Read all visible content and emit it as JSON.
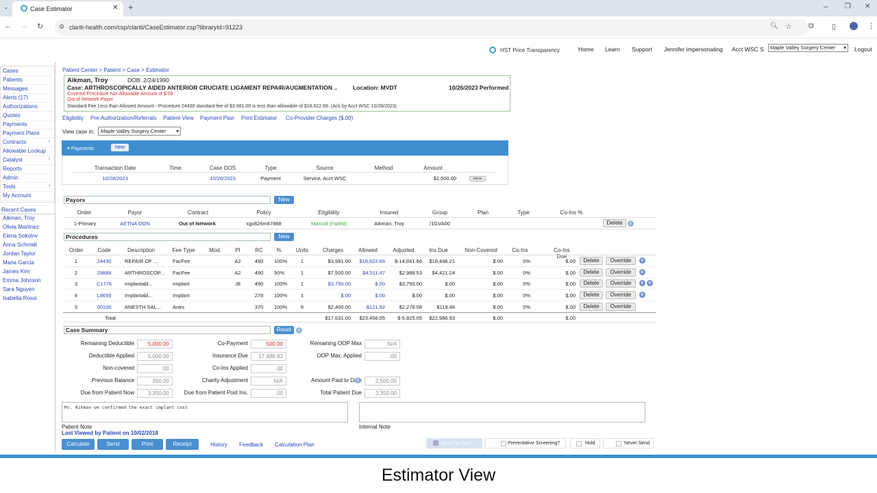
{
  "browser": {
    "tab_title": "Case Estimator",
    "url": "clariti-health.com/csp/clariti/CaseEstimator.csp?libraryId=91223"
  },
  "topnav": {
    "brand": "HST Price Transparency",
    "links": [
      "Home",
      "Learn",
      "Support",
      "Jennifer impersonating",
      "Acct WSC S"
    ],
    "facility": "Maple Valley Surgery Center",
    "logout": "Logout"
  },
  "sidebar": {
    "items": [
      "Cases",
      "Patients",
      "Messages",
      "Alerts (17)",
      "Authorizations",
      "Quotes",
      "Payments",
      "Payment Plans",
      "Contracts",
      "Allowable Lookup",
      "Catalyst",
      "Reports",
      "Admin",
      "Tools",
      "My Account"
    ],
    "recent_title": "Recent Cases",
    "recent": [
      "Aikman, Troy",
      "Olivia Martinez",
      "Elena Sokolov",
      "Anna Schmidt",
      "Jordan Taylor",
      "Maria Garcia",
      "James Kim",
      "Emma Johnson",
      "Sara Nguyen",
      "Isabella Rossi"
    ]
  },
  "breadcrumb": "Patient Center > Patient > Case > Estimator",
  "patient": {
    "name": "Aikman, Troy",
    "dob": "DOB: 2/24/1990",
    "case": "Case: ARTHROSCOPICALLY AIDED ANTERIOR CRUCIATE LIGAMENT REPAIR/AUGMENTATION ..",
    "location": "Location: MVDT",
    "performed": "10/26/2023 Performed",
    "warn1": "Covered Procedure has Allowable Amount of $.00",
    "warn2": "Out of Network Payor",
    "fee_note": "Standard Fee Less than Allowed Amount - Procedure 24430 standard fee of $3,981.00 is less than allowable of $18,822.66. (Ack by Acct WSC 10/28/2023)"
  },
  "links": [
    "Eligibility",
    "Pre-Authorization/Referrals",
    "Patient-View",
    "Payment Plan",
    "Print Estimator",
    "Co-Provider Charges ($.00)"
  ],
  "view_case": {
    "label": "View case in:",
    "value": "Maple Valley Surgery Center"
  },
  "payments": {
    "title": "Payments",
    "new": "New",
    "headers": [
      "Transaction Date",
      "Time",
      "Case DOS",
      "Type",
      "Source",
      "Method",
      "Amount"
    ],
    "row": {
      "date": "10/28/2023",
      "time": "",
      "dos": "10/26/2023",
      "type": "Payment",
      "source": "Service, Acct WSC",
      "method": "",
      "amount": "$2,500.00",
      "action": "Delete"
    }
  },
  "payors": {
    "title": "Payors",
    "new": "New",
    "headers": [
      "Order",
      "Payor",
      "Contract",
      "Policy",
      "Eligibility",
      "Insured",
      "Group",
      "Plan",
      "Type",
      "Co-Ins %"
    ],
    "row": {
      "order": "1-Primary",
      "payor": "AETNA OON",
      "contract": "Out of Network",
      "policy": "xgv826m87888",
      "eligibility": "Manual (Failed)",
      "insured": "Aikman, Troy",
      "group": "/1GVA00",
      "plan": "",
      "type": "",
      "coins": "",
      "delete": "Delete"
    }
  },
  "procedures": {
    "title": "Procedures",
    "new": "New",
    "headers": [
      "Order",
      "Code",
      "Description",
      "Fee Type",
      "Mod.",
      "PI",
      "RC",
      "%",
      "Units",
      "Charges",
      "Allowed",
      "Adjusted",
      "Ins Due",
      "Non-Covered",
      "Co-Ins",
      "Co-Ins Due"
    ],
    "rows": [
      {
        "order": "1",
        "code": "24430",
        "desc": "REPAIR OF ...",
        "fee": "FacFee",
        "mod": "",
        "pi": "A2",
        "rc": "490",
        "pct": "100%",
        "units": "1",
        "charges": "$3,981.00",
        "allowed": "$18,822.66",
        "adjusted": "$-14,841.66",
        "insdue": "$18,446.21",
        "noncov": "$.00",
        "coins": "0%",
        "coinsdue": "$.00"
      },
      {
        "order": "2",
        "code": "29888",
        "desc": "ARTHROSCOP...",
        "fee": "FacFee",
        "mod": "",
        "pi": "A2",
        "rc": "490",
        "pct": "50%",
        "units": "1",
        "charges": "$7,500.00",
        "allowed": "$4,511.47",
        "adjusted": "$2,988.53",
        "insdue": "$4,421.24",
        "noncov": "$.00",
        "coins": "0%",
        "coinsdue": "$.00"
      },
      {
        "order": "3",
        "code": "C1776",
        "desc": "Implantabl...",
        "fee": "Implant",
        "mod": "",
        "pi": "J8",
        "rc": "490",
        "pct": "100%",
        "units": "1",
        "charges": "$3,750.00",
        "allowed": "$.00",
        "adjusted": "$3,750.00",
        "insdue": "$.00",
        "noncov": "$.00",
        "coins": "0%",
        "coinsdue": "$.00"
      },
      {
        "order": "4",
        "code": "L8699",
        "desc": "Implantabl...",
        "fee": "Implant",
        "mod": "",
        "pi": "",
        "rc": "278",
        "pct": "100%",
        "units": "1",
        "charges": "$.00",
        "allowed": "$.00",
        "adjusted": "$.00",
        "insdue": "$.00",
        "noncov": "$.00",
        "coins": "0%",
        "coinsdue": "$.00"
      },
      {
        "order": "5",
        "code": "00100",
        "desc": "ANESTH SAL...",
        "fee": "Anes",
        "mod": "",
        "pi": "",
        "rc": "370",
        "pct": "100%",
        "units": "6",
        "charges": "$2,400.00",
        "allowed": "$121.92",
        "adjusted": "$2,278.08",
        "insdue": "$119.48",
        "noncov": "$.00",
        "coins": "0%",
        "coinsdue": "$.00"
      }
    ],
    "total": {
      "label": "Total",
      "charges": "$17,631.00",
      "allowed": "$23,456.05",
      "adjusted": "$-5,825.05",
      "insdue": "$22,986.93",
      "noncov": "$.00",
      "coinsdue": "$.00"
    },
    "delete": "Delete",
    "override": "Override"
  },
  "summary": {
    "title": "Case Summary",
    "reset": "Reset",
    "col1": [
      {
        "label": "Remaining Deductible",
        "value": "5,000.00"
      },
      {
        "label": "Deductible Applied",
        "value": "5,000.00"
      },
      {
        "label": "Non-covered",
        "value": ".00"
      },
      {
        "label": "Previous Balance",
        "value": "350.00"
      },
      {
        "label": "Due from Patient Now",
        "value": "3,350.00"
      }
    ],
    "col2": [
      {
        "label": "Co-Payment",
        "value": "500.00"
      },
      {
        "label": "Insurance Due",
        "value": "17,486.93"
      },
      {
        "label": "Co-Ins Applied",
        "value": ".00"
      },
      {
        "label": "Charity Adjustment",
        "value": "N/A"
      },
      {
        "label": "Due from Patient Post Ins.",
        "value": ".00"
      }
    ],
    "col3": [
      {
        "label": "Remaining OOP Max",
        "value": "N/A"
      },
      {
        "label": "OOP Max. Applied",
        "value": ".00"
      },
      {
        "label": "",
        "value": ""
      },
      {
        "label": "Amount Paid to Date",
        "value": "2,500.00"
      },
      {
        "label": "Total Patient Due",
        "value": "3,350.00"
      }
    ]
  },
  "notes": {
    "patient_text": "Mr. Aikman we confirmed the exact implant cost",
    "patient_label": "Patient Note",
    "internal_label": "Internal Note",
    "last_viewed": "Last Viewed by Patient on 10/02/2018"
  },
  "actions": {
    "buttons": [
      "Calculate",
      "Send",
      "Print",
      "Receipt"
    ],
    "links": [
      "History",
      "Feedback",
      "Calculation Plan"
    ],
    "checks": [
      "Allow Pay Plan?",
      "Preventative Screening?",
      "Hold",
      "Never Send"
    ]
  },
  "caption": "Estimator View"
}
